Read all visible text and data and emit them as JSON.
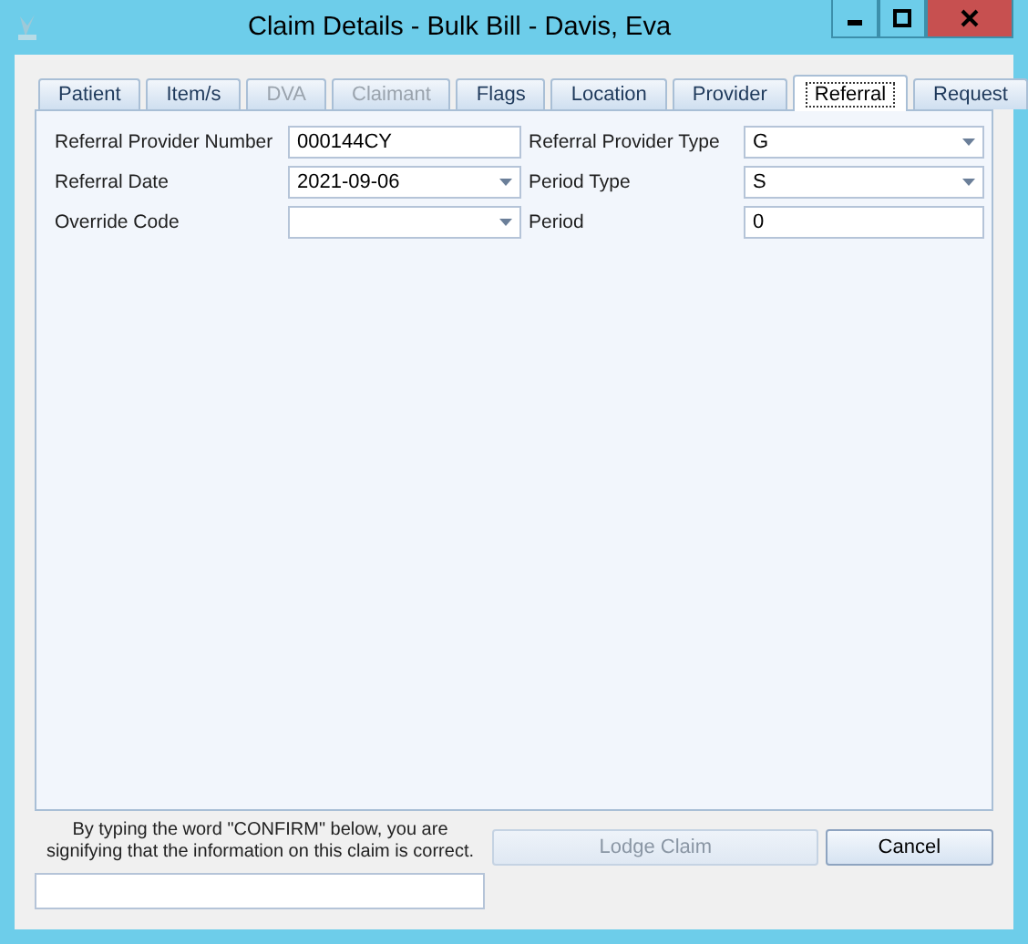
{
  "window": {
    "title": "Claim Details - Bulk Bill - Davis, Eva"
  },
  "tabs": [
    {
      "label": "Patient",
      "selected": false,
      "disabled": false
    },
    {
      "label": "Item/s",
      "selected": false,
      "disabled": false
    },
    {
      "label": "DVA",
      "selected": false,
      "disabled": true
    },
    {
      "label": "Claimant",
      "selected": false,
      "disabled": true
    },
    {
      "label": "Flags",
      "selected": false,
      "disabled": false
    },
    {
      "label": "Location",
      "selected": false,
      "disabled": false
    },
    {
      "label": "Provider",
      "selected": false,
      "disabled": false
    },
    {
      "label": "Referral",
      "selected": true,
      "disabled": false
    },
    {
      "label": "Request",
      "selected": false,
      "disabled": false
    }
  ],
  "fields": [
    {
      "label": "Referral Provider Number",
      "kind": "text",
      "value": "000144CY"
    },
    {
      "label": "Referral Provider Type",
      "kind": "dropdown",
      "value": "G"
    },
    {
      "label": "Referral Date",
      "kind": "dropdown",
      "value": "2021-09-06"
    },
    {
      "label": "Period Type",
      "kind": "dropdown",
      "value": "S"
    },
    {
      "label": "Override Code",
      "kind": "dropdown"
    },
    {
      "label": "Period",
      "kind": "text",
      "value": "0"
    }
  ],
  "confirm": {
    "notice": "By typing the word \"CONFIRM\" below, you are signifying that the information on this claim is correct."
  },
  "buttons": [
    {
      "label": "Lodge Claim",
      "disabled": true
    },
    {
      "label": "Cancel",
      "disabled": false
    }
  ]
}
